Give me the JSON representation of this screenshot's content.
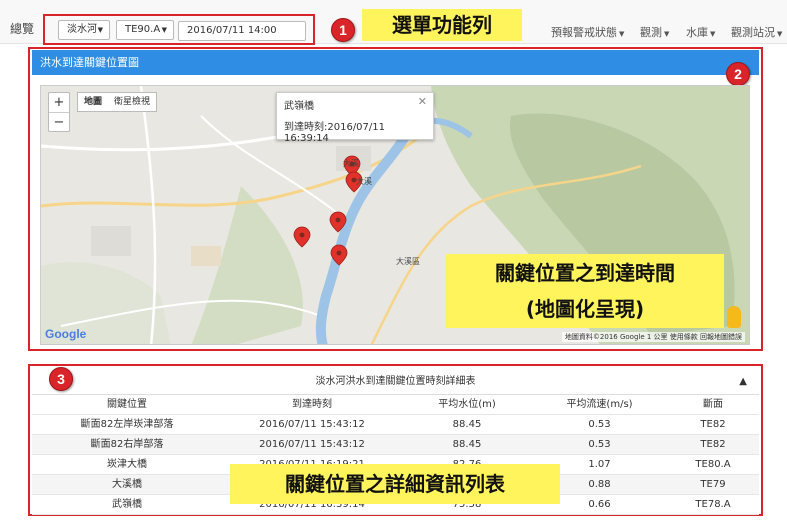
{
  "nav": {
    "brand": "總覽",
    "river_select": "淡水河",
    "station_select": "TE90.A",
    "datetime_input": "2016/07/11 14:00",
    "menu": [
      "預報警戒狀態",
      "觀測",
      "水庫",
      "觀測站況"
    ]
  },
  "annotations": {
    "badge1": "1",
    "callout1": "選單功能列",
    "badge2": "2",
    "callout2_line1": "關鍵位置之到達時間",
    "callout2_line2": "(地圖化呈現)",
    "badge3": "3",
    "callout3": "關鍵位置之詳細資訊列表"
  },
  "map_panel": {
    "title": "洪水到達關鍵位置圖",
    "zoom_in": "+",
    "zoom_out": "−",
    "map_type_map": "地圖",
    "map_type_satellite": "衛星檢視",
    "popup_name": "武嶺橋",
    "popup_time": "到達時刻:2016/07/11 16:39:14",
    "popup_close": "✕",
    "google_logo": "Google",
    "attribution": "地圖資料©2016 Google  1 公里  使用條款  回報地圖錯誤",
    "labels": [
      "大溪",
      "大溪",
      "大溪區"
    ]
  },
  "table_panel": {
    "title": "淡水河洪水到達關鍵位置時刻詳細表",
    "collapse": "▲",
    "headers": [
      "關鍵位置",
      "到達時刻",
      "平均水位(m)",
      "平均流速(m/s)",
      "斷面"
    ],
    "rows": [
      [
        "斷面82左岸崁津部落",
        "2016/07/11 15:43:12",
        "88.45",
        "0.53",
        "TE82"
      ],
      [
        "斷面82右岸部落",
        "2016/07/11 15:43:12",
        "88.45",
        "0.53",
        "TE82"
      ],
      [
        "崁津大橋",
        "2016/07/11 16:19:21",
        "82.76",
        "1.07",
        "TE80.A"
      ],
      [
        "大溪橋",
        "",
        "",
        "0.88",
        "TE79"
      ],
      [
        "武嶺橋",
        "2016/07/11 16:39:14",
        "75.58",
        "0.66",
        "TE78.A"
      ]
    ]
  },
  "colors": {
    "accent_blue": "#2f8ee4",
    "highlight_red": "#d9252a",
    "callout_yellow": "#fff45c",
    "marker_red": "#e0312b"
  }
}
